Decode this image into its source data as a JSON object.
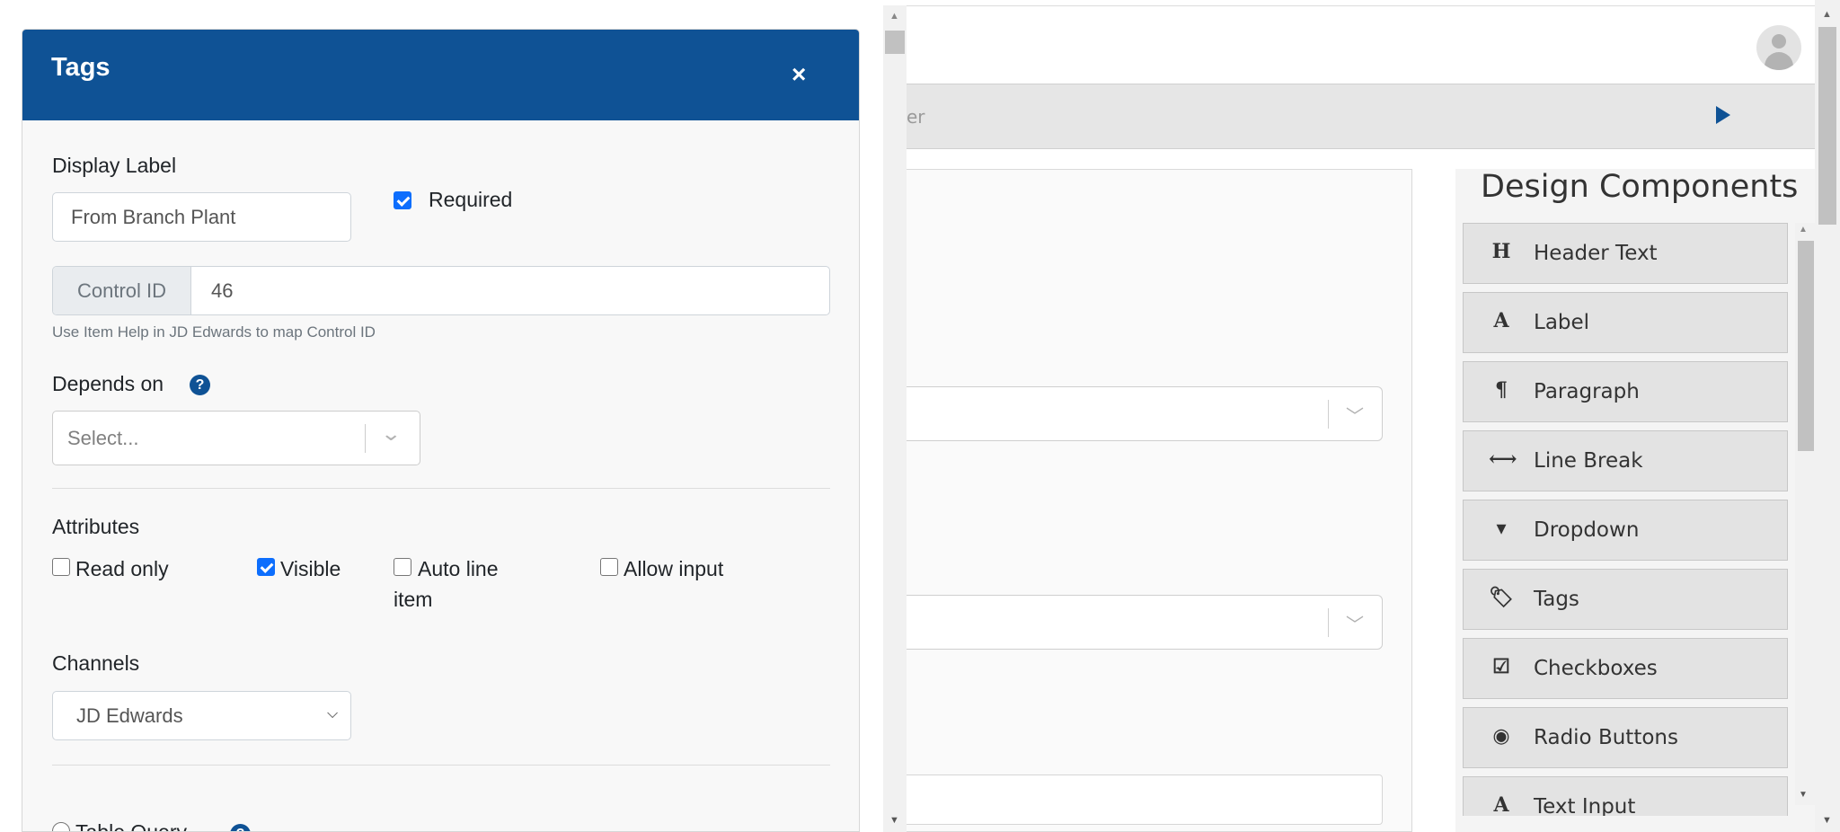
{
  "modal": {
    "title": "Tags",
    "close_icon": "×",
    "display_label": {
      "label": "Display Label",
      "value": "From Branch Plant"
    },
    "required": {
      "label": "Required",
      "checked": true
    },
    "control_id": {
      "addon": "Control ID",
      "value": "46",
      "help": "Use Item Help in JD Edwards to map Control ID"
    },
    "depends_on": {
      "label": "Depends on",
      "help_icon": "?",
      "placeholder": "Select..."
    },
    "attributes": {
      "heading": "Attributes",
      "options": [
        {
          "label": "Read only",
          "checked": false
        },
        {
          "label": "Visible",
          "checked": true
        },
        {
          "label_line1": "Auto line",
          "label_line2": "item",
          "checked": false
        },
        {
          "label": "Allow input",
          "checked": false
        }
      ]
    },
    "channels": {
      "heading": "Channels",
      "selected": "JD Edwards"
    },
    "table_query": {
      "label": "Table Query",
      "help_icon": "?"
    }
  },
  "background": {
    "name_bar_text": "er",
    "play_icon": "play-icon"
  },
  "design_components": {
    "title": "Design Components",
    "items": [
      {
        "icon": "H",
        "label": "Header Text"
      },
      {
        "icon": "A",
        "label": "Label"
      },
      {
        "icon": "¶",
        "label": "Paragraph"
      },
      {
        "icon": "⟷",
        "label": "Line Break"
      },
      {
        "icon": "▾",
        "label": "Dropdown"
      },
      {
        "icon": "🏷",
        "label": "Tags"
      },
      {
        "icon": "☑",
        "label": "Checkboxes"
      },
      {
        "icon": "◉",
        "label": "Radio Buttons"
      },
      {
        "icon": "A",
        "label": "Text Input"
      }
    ]
  },
  "colors": {
    "primary": "#0f5295",
    "checkbox_checked": "#0d6efd"
  }
}
